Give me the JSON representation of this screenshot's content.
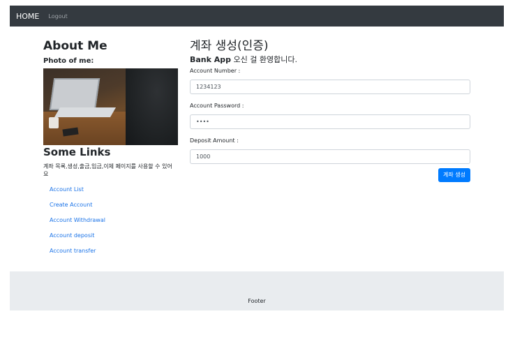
{
  "navbar": {
    "brand": "HOME",
    "logout": "Logout"
  },
  "sidebar": {
    "about_title": "About Me",
    "photo_label": "Photo of me:",
    "links_title": "Some Links",
    "links_desc": "계좌 목록,생성,출금,입금,이체 페이지를 사용할 수 있어요",
    "links": [
      {
        "label": "Account List"
      },
      {
        "label": "Create Account"
      },
      {
        "label": "Account Withdrawal"
      },
      {
        "label": "Account deposit"
      },
      {
        "label": "Account transfer"
      }
    ]
  },
  "main": {
    "title": "계좌 생성(인증)",
    "welcome_bold": "Bank App",
    "welcome_rest": " 오신 걸 환영합니다.",
    "fields": [
      {
        "label": "Account Number :",
        "value": "1234123"
      },
      {
        "label": "Account Password :",
        "value": "••••"
      },
      {
        "label": "Deposit Amount :",
        "value": "1000"
      }
    ],
    "submit_label": "계좌 생성"
  },
  "footer": {
    "text": "Footer"
  },
  "colors": {
    "navbar": "#343a40",
    "primary": "#007bff",
    "link": "#1a73e8",
    "footer": "#e9ecef"
  }
}
